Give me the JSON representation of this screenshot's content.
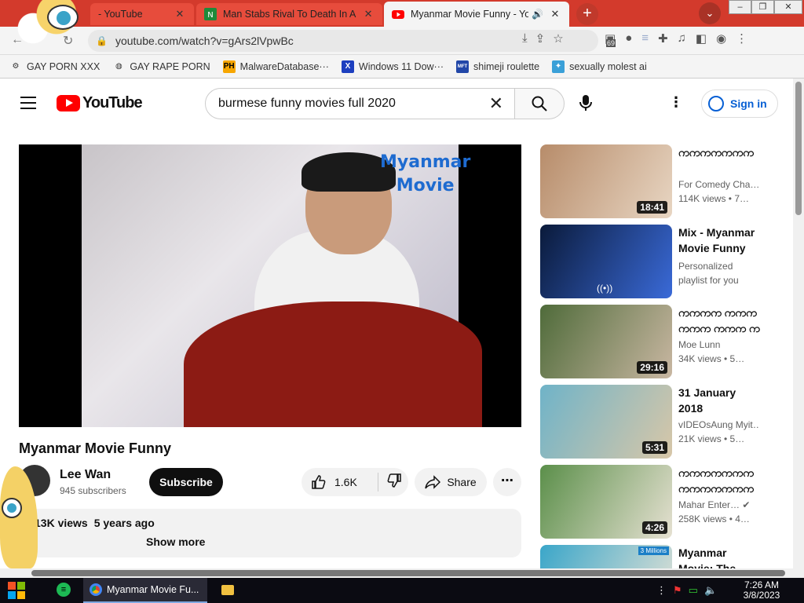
{
  "browser": {
    "tabs": [
      {
        "title": "- YouTube",
        "favicon": "youtube-icon"
      },
      {
        "title": "Man Stabs Rival To Death In A",
        "favicon": "site-icon"
      },
      {
        "title": "Myanmar Movie Funny - Yo",
        "favicon": "youtube-icon",
        "active": true
      }
    ],
    "url": "youtube.com/watch?v=gArs2lVpwBc",
    "extension_badge": "69",
    "bookmarks": [
      {
        "label": "GAY PORN XXX",
        "icon": "gear-icon"
      },
      {
        "label": "GAY RAPE PORN",
        "icon": "globe-icon"
      },
      {
        "label": "MalwareDatabase···",
        "icon": "ph-icon",
        "icon_text": "PH"
      },
      {
        "label": "Windows 11 Dow···",
        "icon": "x-icon",
        "icon_text": "X"
      },
      {
        "label": "shimeji roulette",
        "icon": "mft-icon",
        "icon_text": "MFT"
      },
      {
        "label": "sexually molest ai",
        "icon": "app-icon"
      }
    ]
  },
  "youtube": {
    "logo_text": "YouTube",
    "search_value": "burmese funny movies full 2020",
    "sign_in": "Sign in",
    "video": {
      "title": "Myanmar Movie Funny",
      "watermark_line1": "Myanmar",
      "watermark_line2": "Movie",
      "channel": "Lee Wan",
      "subscribers": "945 subscribers",
      "subscribe_label": "Subscribe",
      "likes": "1.6K",
      "share_label": "Share",
      "views": "13K views",
      "age": "5 years ago",
      "show_more": "Show more"
    },
    "recommendations": [
      {
        "title": "ကကကကကကက",
        "channel": "For Comedy Cha…",
        "views": "114K views  • 7…",
        "duration": "18:41",
        "colors": [
          "#b78c6a",
          "#e8d6c3"
        ]
      },
      {
        "title": "Mix - Myanmar Movie Funny",
        "channel": "Personalized playlist for you",
        "views": "",
        "duration": "((•))",
        "colors": [
          "#0a1a3a",
          "#3a6ad8"
        ],
        "playlist": true
      },
      {
        "title": "ကကကက ကကက ကကက ကကက ကကကကကကကက ကကကက...",
        "channel": "Moe Lunn",
        "views": "34K views  • 5…",
        "duration": "29:16",
        "colors": [
          "#4f6b3a",
          "#c9b7a2"
        ]
      },
      {
        "title": "31 January 2018",
        "channel": "vIDEOsAung Myit…",
        "views": "21K views  • 5…",
        "duration": "5:31",
        "colors": [
          "#6fb3c8",
          "#d8c7a8"
        ]
      },
      {
        "title": "ကကကကကကကကကကကကကကက- ကကကကကကကကကကကက...",
        "channel": "Mahar Enter… ✔",
        "views": "258K views  • 4…",
        "duration": "4:26",
        "colors": [
          "#5b8f4a",
          "#e6e1d2"
        ]
      },
      {
        "title": "Myanmar Movie: The",
        "channel": "",
        "views": "",
        "duration": "",
        "colors": [
          "#3aa6c9",
          "#e9e4d6"
        ],
        "thumb_text": "3 Millions"
      }
    ]
  },
  "taskbar": {
    "chrome_label": "Myanmar Movie Fu...",
    "time": "7:26 AM",
    "date": "3/8/2023"
  },
  "colors": {
    "tabbar": "#d33a2c",
    "youtube_red": "#ff0000",
    "link_blue": "#065fd4"
  }
}
